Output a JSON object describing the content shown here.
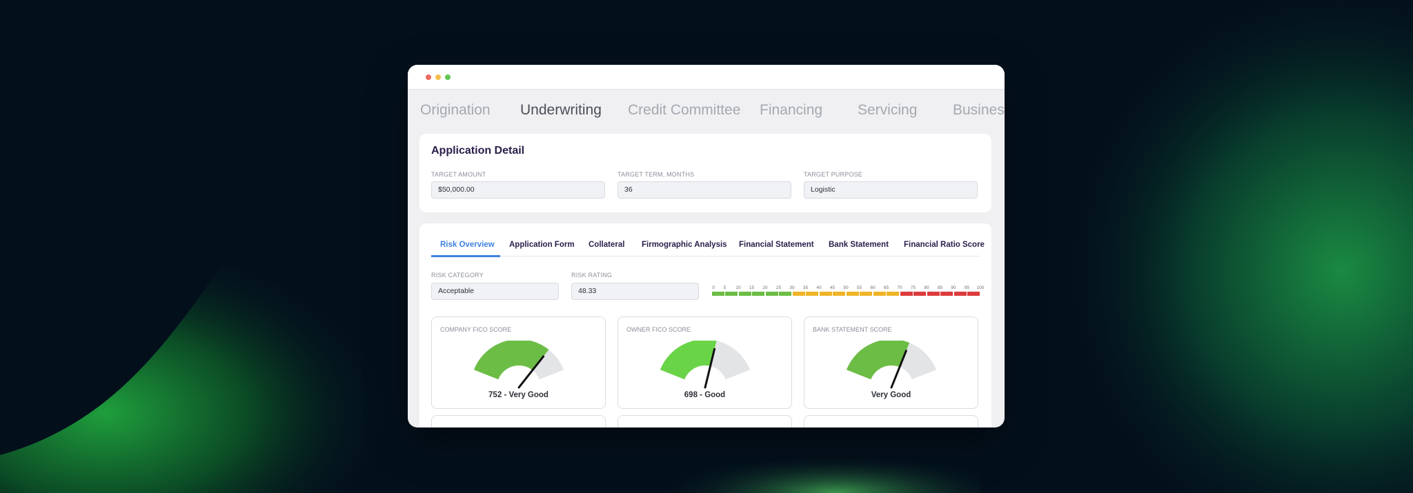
{
  "colors": {
    "accent_blue": "#3f82e0",
    "title_purple": "#2a1d4a",
    "dot_red": "#ec6a5e",
    "dot_yellow": "#f4bf4f",
    "dot_green": "#61c554",
    "risk_green": "#6cbd45",
    "risk_yellow": "#f0b429",
    "risk_red": "#dc3c3c"
  },
  "stages": [
    "Origination",
    "Underwriting",
    "Credit Committee",
    "Financing",
    "Servicing",
    "Busines"
  ],
  "active_stage": "Underwriting",
  "application_detail": {
    "title": "Application Detail",
    "fields": [
      {
        "label": "TARGET AMOUNT",
        "value": "$50,000.00"
      },
      {
        "label": "TARGET TERM, MONTHS",
        "value": "36"
      },
      {
        "label": "TARGET PURPOSE",
        "value": "Logistic"
      }
    ]
  },
  "tabs": [
    "Risk Overview",
    "Application Form",
    "Collateral",
    "Firmographic Analysis",
    "Financial Statement",
    "Bank Statement",
    "Financial Ratio Score"
  ],
  "active_tab": "Risk Overview",
  "risk": {
    "category_label": "RISK CATEGORY",
    "category_value": "Acceptable",
    "rating_label": "RISK RATING",
    "rating_value": "48.33",
    "scale_ticks": [
      "0",
      "5",
      "10",
      "15",
      "20",
      "25",
      "30",
      "35",
      "40",
      "45",
      "50",
      "55",
      "60",
      "65",
      "70",
      "75",
      "80",
      "85",
      "90",
      "95",
      "100"
    ],
    "scale_colors": [
      "green",
      "green",
      "green",
      "green",
      "green",
      "green",
      "yellow",
      "yellow",
      "yellow",
      "yellow",
      "yellow",
      "yellow",
      "yellow",
      "yellow",
      "red",
      "red",
      "red",
      "red",
      "red",
      "red"
    ]
  },
  "gauges": [
    {
      "label": "COMPANY FICO SCORE",
      "value_text": "752 - Very Good",
      "fraction": 0.78,
      "color": "#6cbd45"
    },
    {
      "label": "OWNER FICO SCORE",
      "value_text": "698 - Good",
      "fraction": 0.6,
      "color": "#6ad448"
    },
    {
      "label": "BANK STATEMENT SCORE",
      "value_text": "Very Good",
      "fraction": 0.66,
      "color": "#6cbd45"
    }
  ]
}
